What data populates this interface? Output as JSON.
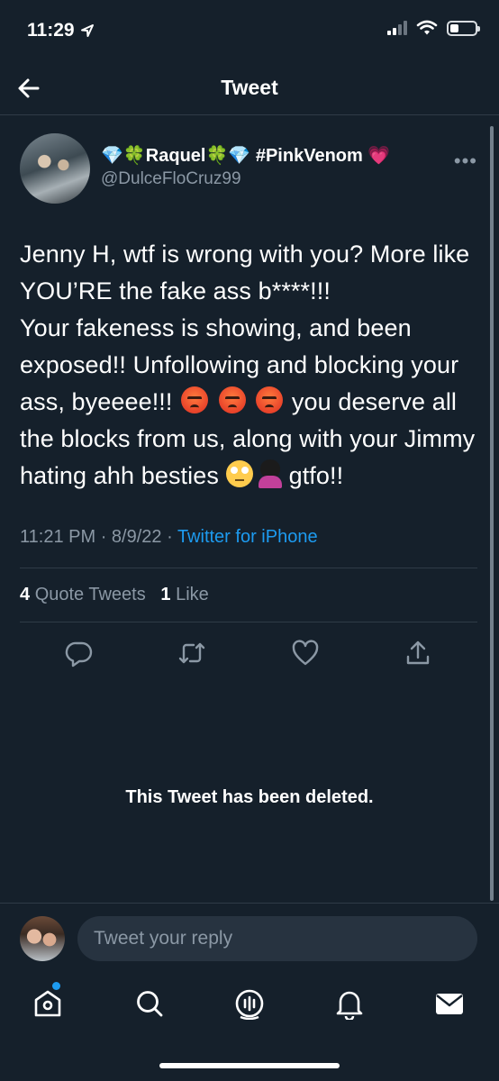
{
  "status_bar": {
    "time": "11:29"
  },
  "header": {
    "title": "Tweet"
  },
  "tweet": {
    "display_name": "💎🍀Raquel🍀💎 #PinkVenom 💗",
    "handle": "@DulceFloCruz99",
    "text_part1": "Jenny H, wtf is wrong with you? More like YOU’RE the fake ass b****!!!\nYour fakeness is showing, and been exposed!! Unfollowing and blocking your ass, byeeee!!! ",
    "text_part2": " you deserve all the blocks from us, along with your Jimmy hating ahh besties ",
    "text_part3": "gtfo!!",
    "time": "11:21 PM",
    "date": "8/9/22",
    "source": "Twitter for iPhone",
    "quote_count": "4",
    "quote_label": "Quote Tweets",
    "like_count": "1",
    "like_label": "Like"
  },
  "deleted_notice": "This Tweet has been deleted.",
  "reply": {
    "placeholder": "Tweet your reply"
  },
  "icons": {
    "back": "arrow-left-icon",
    "more": "more-horizontal-icon",
    "reply": "reply-icon",
    "retweet": "retweet-icon",
    "like": "heart-icon",
    "share": "share-icon",
    "tabs": [
      "home-icon",
      "search-icon",
      "spaces-icon",
      "notifications-icon",
      "messages-icon"
    ]
  },
  "colors": {
    "background": "#15202b",
    "accent": "#1d9bf0",
    "secondary_text": "#8b98a5"
  }
}
